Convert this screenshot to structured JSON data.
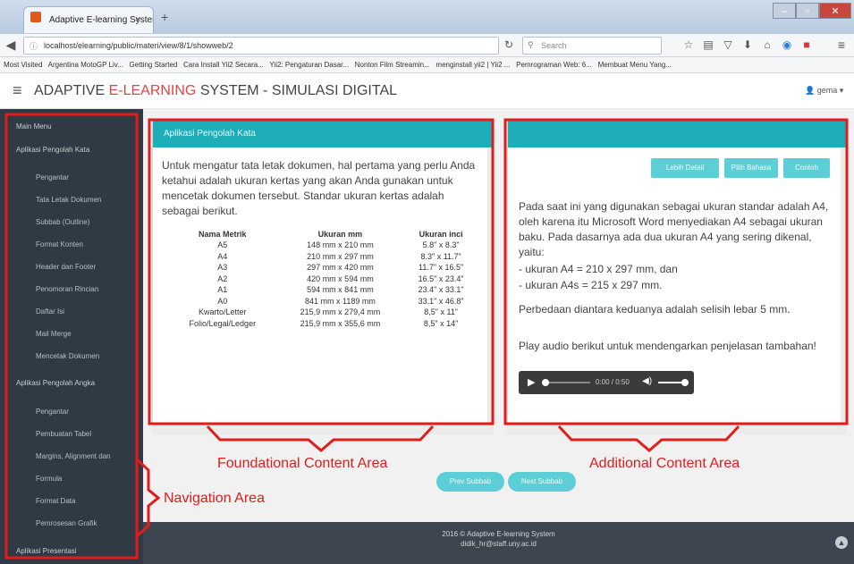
{
  "browser": {
    "tab_title": "Adaptive E-learning System",
    "tab_close": "×",
    "new_tab": "+",
    "url": "localhost/elearning/public/materi/view/8/1/showweb/2",
    "search_placeholder": "Search",
    "bookmarks": [
      "Most Visited",
      "Argentina MotoGP Liv...",
      "Getting Started",
      "Cara Install Yii2 Secara...",
      "Yii2: Pengaturan Dasar...",
      "Nonton Film Streamin...",
      "menginstall yii2 | Yii2 ...",
      "Pemrograman Web: 6...",
      "Membuat Menu Yang..."
    ]
  },
  "app": {
    "title_prefix": "ADAPTIVE ",
    "title_highlight": "E-LEARNING",
    "title_suffix": " SYSTEM - SIMULASI DIGITAL",
    "user": "gema"
  },
  "sidebar": {
    "main_menu": "Main Menu",
    "group1": "Aplikasi Pengolah Kata",
    "group1_items": [
      "Pengantar",
      "Tata Letak Dokumen",
      "Subbab (Outline)",
      "Format Konten",
      "Header dan Footer",
      "Penomoran Rincian",
      "Daftar Isi",
      "Mail Merge",
      "Mencetak Dokumen"
    ],
    "group2": "Aplikasi Pengolah Angka",
    "group2_items": [
      "Pengantar",
      "Pembuatan Tabel",
      "Margins, Alignment dan",
      "Formula",
      "Format Data",
      "Pemrosesan Grafik"
    ],
    "group3": "Aplikasi Presentasi"
  },
  "left_panel": {
    "heading": "Aplikasi Pengolah Kata",
    "intro": "Untuk mengatur tata letak dokumen, hal pertama yang perlu Anda ketahui adalah ukuran kertas yang akan Anda gunakan untuk mencetak dokumen tersebut. Standar ukuran kertas adalah sebagai berikut.",
    "table": {
      "headers": [
        "Nama Metrik",
        "Ukuran mm",
        "Ukuran inci"
      ],
      "rows": [
        [
          "A5",
          "148 mm x 210 mm",
          "5.8\" x 8.3\""
        ],
        [
          "A4",
          "210 mm x 297 mm",
          "8.3\" x 11.7\""
        ],
        [
          "A3",
          "297 mm x 420 mm",
          "11.7\" x 16.5\""
        ],
        [
          "A2",
          "420 mm x 594 mm",
          "16.5\" x 23.4\""
        ],
        [
          "A1",
          "594 mm x 841 mm",
          "23.4\" x 33.1\""
        ],
        [
          "A0",
          "841 mm x 1189 mm",
          "33.1\" x 46.8\""
        ],
        [
          "Kwarto/Letter",
          "215,9 mm x 279,4 mm",
          "8,5\" x 11\""
        ],
        [
          "Folio/Legal/Ledger",
          "215,9 mm x 355,6 mm",
          "8,5\" x 14\""
        ]
      ]
    }
  },
  "right_panel": {
    "buttons": [
      "Lebih Detail",
      "Pilih Bahasa",
      "Contoh"
    ],
    "para1": "Pada saat ini yang digunakan sebagai ukuran standar adalah A4, oleh karena itu Microsoft Word menyediakan A4 sebagai ukuran baku. Pada dasarnya ada dua ukuran A4 yang sering dikenal, yaitu:",
    "bullet1": "- ukuran A4 = 210 x 297 mm, dan",
    "bullet2": "- ukuran A4s = 215 x 297 mm.",
    "para2": "Perbedaan diantara keduanya adalah selisih lebar 5 mm.",
    "para3": "Play audio berikut untuk mendengarkan penjelasan tambahan!",
    "audio_time": "0:00 / 0:50"
  },
  "nav_buttons": {
    "prev": "Prev Subbab",
    "next": "Next Subbab"
  },
  "footer": {
    "line1": "2016 © Adaptive E-learning System",
    "line2": "didik_hr@staff.uny.ac.id"
  },
  "annotations": {
    "foundational": "Foundational Content Area",
    "additional": "Additional Content Area",
    "navigation": "Navigation Area"
  },
  "colors": {
    "accent": "#1eaeb7",
    "annotation": "#e31b1b",
    "sidebar": "#2f3a44"
  }
}
